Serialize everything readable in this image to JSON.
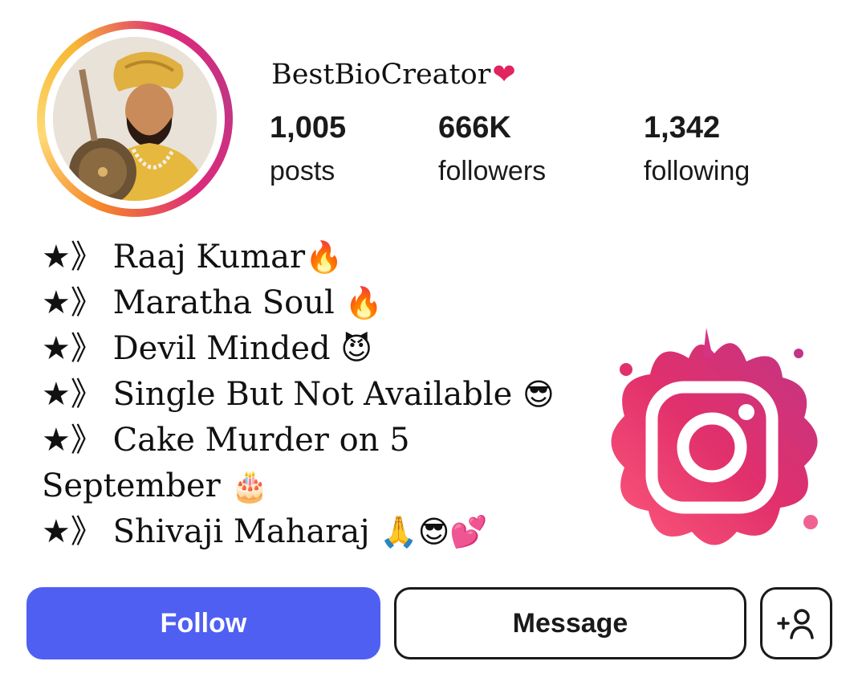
{
  "profile": {
    "username": "BestBioCreator",
    "username_emoji": "❤",
    "stats": {
      "posts": {
        "value": "1,005",
        "label": "posts"
      },
      "followers": {
        "value": "666K",
        "label": "followers"
      },
      "following": {
        "value": "1,342",
        "label": "following"
      }
    }
  },
  "bio": [
    {
      "prefix": "★》",
      "text": " Raaj Kumar",
      "emoji": "🔥"
    },
    {
      "prefix": "★》",
      "text": " Maratha Soul ",
      "emoji": "🔥"
    },
    {
      "prefix": "★》",
      "text": " Devil Minded ",
      "emoji": "😈"
    },
    {
      "prefix": "★》",
      "text": " Single But Not Available ",
      "emoji": "😎"
    },
    {
      "prefix": "★》",
      "text": " Cake Murder on 5 September ",
      "emoji": "🎂"
    },
    {
      "prefix": "★》",
      "text": " Shivaji Maharaj ",
      "emoji": "🙏😎💕"
    }
  ],
  "buttons": {
    "follow": "Follow",
    "message": "Message",
    "add_user_icon": "add-person-icon"
  },
  "icons": {
    "avatar": "warrior-portrait",
    "decoration": "instagram-logo-splash"
  },
  "colors": {
    "follow_button": "#4f5ff2",
    "heart": "#e0245e",
    "ring_gradient": [
      "#f58529",
      "#feda75",
      "#dd2a7b",
      "#c13584"
    ]
  }
}
